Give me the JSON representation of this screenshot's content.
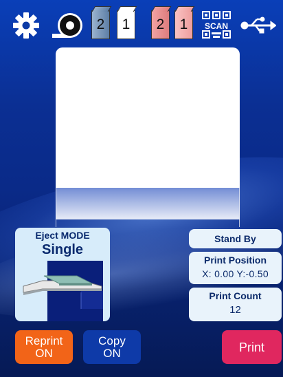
{
  "toolbar": {
    "icons": [
      "gear-icon",
      "ribbon-tape-icon",
      "cartridge-blue-icon",
      "cartridge-white-icon",
      "cartridge-pink-icon",
      "cartridge-pink-icon",
      "scan-icon",
      "usb-icon"
    ],
    "cartridges": [
      {
        "label": "2",
        "color": "#7f9cbf"
      },
      {
        "label": "1",
        "color": "#ffffff"
      },
      {
        "label": "2",
        "color": "#eb8f8f"
      },
      {
        "label": "1",
        "color": "#f5b2b2"
      }
    ],
    "scan_label": "SCAN"
  },
  "eject": {
    "title": "Eject MODE",
    "value": "Single"
  },
  "status": {
    "standby": "Stand By",
    "position_label": "Print Position",
    "position_value": "X: 0.00 Y:-0.50",
    "count_label": "Print Count",
    "count_value": "12"
  },
  "buttons": {
    "reprint_line1": "Reprint",
    "reprint_line2": "ON",
    "copy_line1": "Copy",
    "copy_line2": "ON",
    "print": "Print"
  },
  "colors": {
    "background": "#0b2f93",
    "reprint": "#f26418",
    "copy": "#0e3aa8",
    "print": "#e0275f",
    "panel": "#d7ecfa"
  }
}
